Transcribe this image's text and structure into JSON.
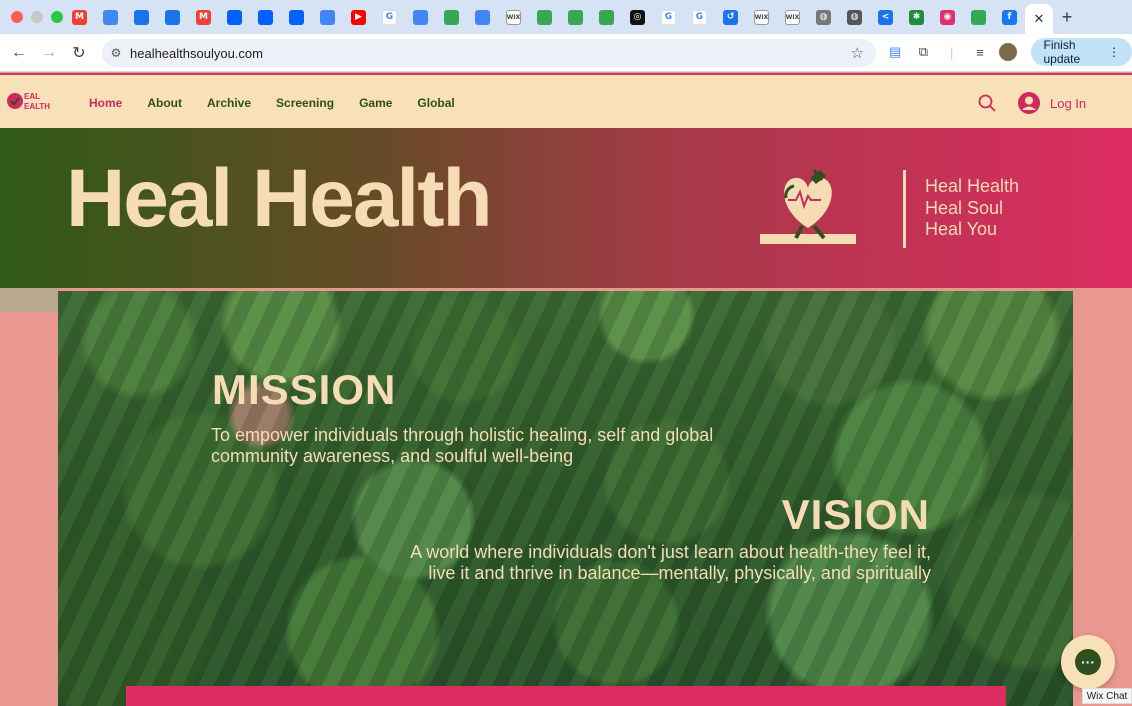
{
  "browser": {
    "traffic_colors": [
      "#ff5f57",
      "#c8c8c8",
      "#28c840"
    ],
    "tabs": [
      {
        "icon": "gmail-icon",
        "glyph": "M",
        "color": "#ea4335"
      },
      {
        "icon": "google-docs-icon",
        "glyph": "",
        "color": "#4285f4"
      },
      {
        "icon": "shield-icon",
        "glyph": "",
        "color": "#1a73e8"
      },
      {
        "icon": "shield-icon",
        "glyph": "",
        "color": "#1a73e8"
      },
      {
        "icon": "gmail-icon",
        "glyph": "M",
        "color": "#ea4335"
      },
      {
        "icon": "dropbox-icon",
        "glyph": "",
        "color": "#0061fe"
      },
      {
        "icon": "dropbox-icon",
        "glyph": "",
        "color": "#0061fe"
      },
      {
        "icon": "dropbox-icon",
        "glyph": "",
        "color": "#0061fe"
      },
      {
        "icon": "google-docs-icon",
        "glyph": "",
        "color": "#4285f4"
      },
      {
        "icon": "youtube-icon",
        "glyph": "▶",
        "color": "#ff0000"
      },
      {
        "icon": "google-icon",
        "glyph": "G",
        "color": "#4285f4"
      },
      {
        "icon": "google-docs-icon",
        "glyph": "",
        "color": "#4285f4"
      },
      {
        "icon": "google-drive-icon",
        "glyph": "",
        "color": "#34a853"
      },
      {
        "icon": "google-docs-icon",
        "glyph": "",
        "color": "#4285f4"
      },
      {
        "icon": "wix-icon",
        "glyph": "WIX",
        "color": "#444444"
      },
      {
        "icon": "google-drive-icon",
        "glyph": "",
        "color": "#34a853"
      },
      {
        "icon": "google-drive-icon",
        "glyph": "",
        "color": "#34a853"
      },
      {
        "icon": "google-drive-icon",
        "glyph": "",
        "color": "#34a853"
      },
      {
        "icon": "openai-icon",
        "glyph": "◎",
        "color": "#111111"
      },
      {
        "icon": "google-icon",
        "glyph": "G",
        "color": "#4285f4"
      },
      {
        "icon": "google-icon",
        "glyph": "G",
        "color": "#4285f4"
      },
      {
        "icon": "history-icon",
        "glyph": "↺",
        "color": "#1a73e8"
      },
      {
        "icon": "wix-icon",
        "glyph": "WIX",
        "color": "#444444"
      },
      {
        "icon": "wix-icon",
        "glyph": "WIX",
        "color": "#444444"
      },
      {
        "icon": "globe-icon",
        "glyph": "◍",
        "color": "#777777"
      },
      {
        "icon": "globe-icon",
        "glyph": "◍",
        "color": "#555555"
      },
      {
        "icon": "share-icon",
        "glyph": "<",
        "color": "#1a73e8"
      },
      {
        "icon": "app-icon",
        "glyph": "✱",
        "color": "#1e8e3e"
      },
      {
        "icon": "instagram-icon",
        "glyph": "◉",
        "color": "#e1306c"
      },
      {
        "icon": "google-drive-icon",
        "glyph": "",
        "color": "#34a853"
      },
      {
        "icon": "facebook-icon",
        "glyph": "f",
        "color": "#1877f2"
      }
    ],
    "active_tab_close": "✕",
    "new_tab": "+",
    "url": "healhealthsoulyou.com",
    "finish_update_label": "Finish update"
  },
  "site": {
    "logo_text": "HEAL HEALTH",
    "nav": [
      "Home",
      "About",
      "Archive",
      "Screening",
      "Game",
      "Global"
    ],
    "active_nav": "Home",
    "login_label": "Log In",
    "accent": "#d02960",
    "green": "#2f4f1f",
    "cream": "#f6dcb5"
  },
  "banner": {
    "title": "Heal Health",
    "taglines": [
      "Heal Health",
      "Heal Soul",
      "Heal You"
    ]
  },
  "mission": {
    "title": "MISSION",
    "text": "To empower individuals through holistic healing, self and global community awareness, and soulful well-being"
  },
  "vision": {
    "title": "VISION",
    "line1": "A world where individuals don't just learn about health-they feel it,",
    "line2": "live it and thrive in balance—mentally, physically, and spiritually"
  },
  "bottom_bar": {
    "left_text": "...",
    "right_text": "..."
  },
  "chat": {
    "label": "Wix Chat"
  }
}
